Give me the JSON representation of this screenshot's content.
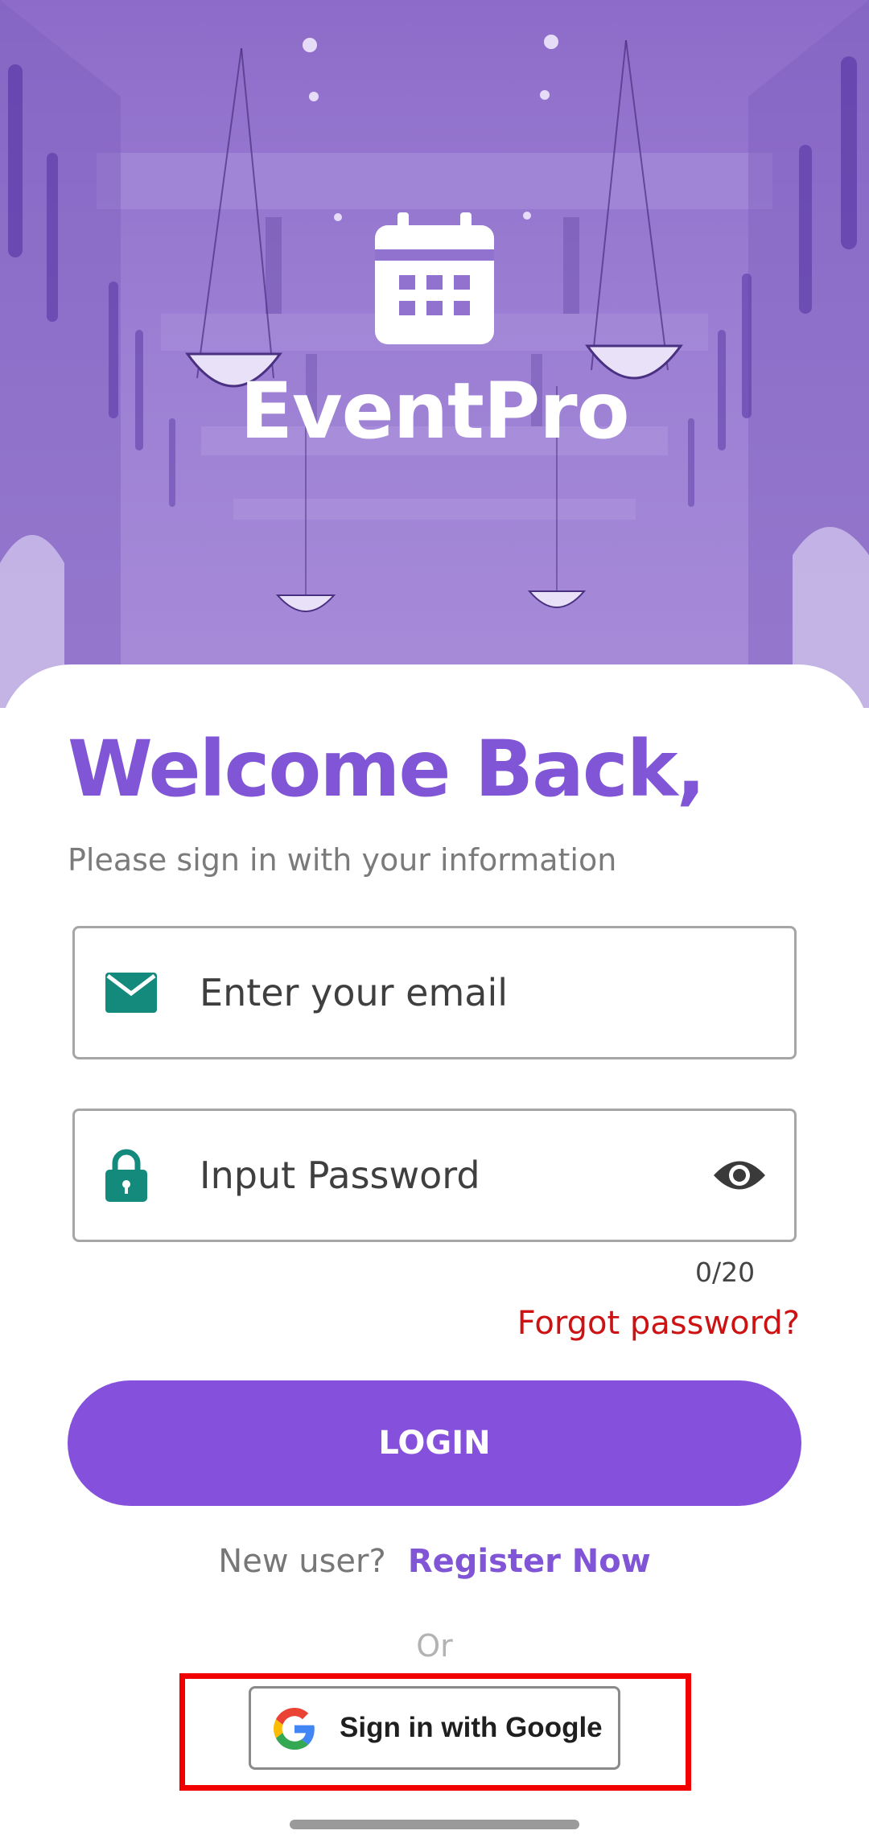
{
  "app": {
    "name": "EventPro",
    "logo_icon": "calendar-icon"
  },
  "login": {
    "heading": "Welcome Back,",
    "subtitle": "Please sign in with your information",
    "email": {
      "placeholder": "Enter your email",
      "value": "",
      "icon": "envelope-icon"
    },
    "password": {
      "placeholder": "Input Password",
      "value": "",
      "icon": "lock-icon",
      "toggle_icon": "eye-icon",
      "counter": "0/20"
    },
    "forgot_password": "Forgot password?",
    "login_button": "LOGIN",
    "new_user_text": "New user?",
    "register_link": "Register Now",
    "divider_text": "Or",
    "google_button": "Sign in with Google",
    "google_icon": "google-icon"
  },
  "colors": {
    "brand_purple": "#8156d6",
    "button_purple": "#8551dc",
    "icon_teal": "#138a7c",
    "error_red": "#cc1212",
    "highlight_red": "#f20000"
  }
}
